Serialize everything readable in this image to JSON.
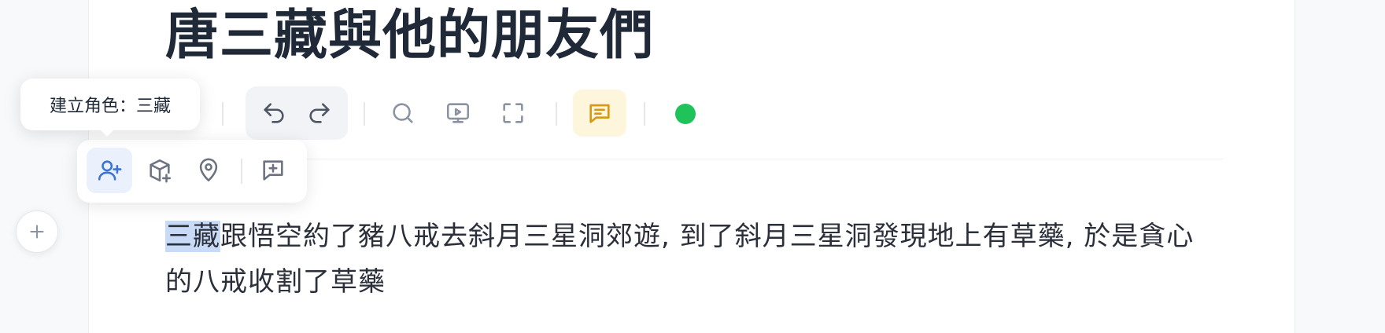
{
  "document": {
    "title": "唐三藏與他的朋友們",
    "paragraph_selected": "三藏",
    "paragraph_rest": "跟悟空約了豬八戒去斜月三星洞郊遊, 到了斜月三星洞發現地上有草藥, 於是貪心的八戒收割了草藥"
  },
  "toolbar": {
    "buttons": [
      "undo-icon",
      "redo-icon",
      "search-icon",
      "presentation-icon",
      "fullscreen-icon",
      "comment-icon"
    ],
    "status_color": "#1fc35a",
    "comment_color": "#d89612"
  },
  "popover": {
    "tooltip": "建立角色：三藏",
    "buttons": [
      "add-person-icon",
      "add-item-icon",
      "location-icon",
      "add-note-icon"
    ],
    "active_color": "#3b74d4"
  },
  "colors": {
    "accent": "#3b74d4",
    "selection": "#c8daf5",
    "icon_gray": "#7a8494"
  }
}
